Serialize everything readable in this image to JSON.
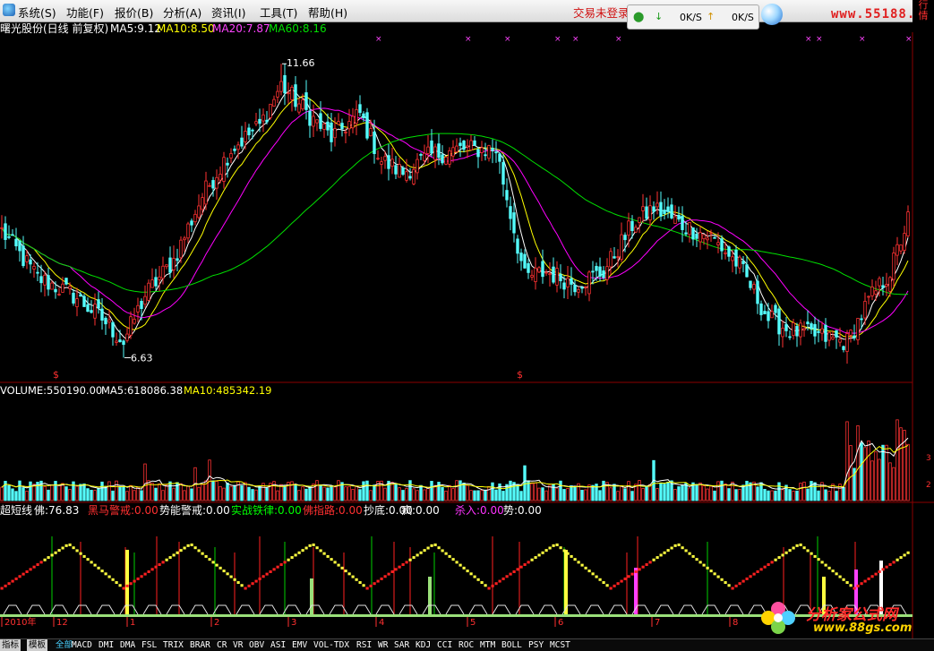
{
  "menu": [
    "系统(S)",
    "功能(F)",
    "报价(B)",
    "分析(A)",
    "资讯(I)",
    "工具(T)",
    "帮助(H)"
  ],
  "trade_status": "交易未登录",
  "speed": {
    "down": "0K/S",
    "up": "0K/S"
  },
  "site_url": "www.55188.com",
  "right_tab": [
    "行",
    "情"
  ],
  "colors": {
    "background": "#000000",
    "up": "#ff3232",
    "down": "#54fcfc",
    "ma5": "#ffffff",
    "ma10": "#ffff00",
    "ma20": "#ff00ff",
    "ma60": "#00e000"
  },
  "price_panel": {
    "title": "曙光股份(日线 前复权)",
    "ma": [
      {
        "label": "MA5:9.12",
        "color": "#ffffff"
      },
      {
        "label": "MA10:8.50",
        "color": "#ffff00"
      },
      {
        "label": "MA20:7.87",
        "color": "#ff44ff"
      },
      {
        "label": "MA60:8.16",
        "color": "#00e000"
      }
    ],
    "high_label": "11.66",
    "low_label": "6.63",
    "dollar": "$",
    "markers": "×"
  },
  "volume_panel": {
    "label": "VOLUME:550190.00",
    "ma5": "MA5:618086.38",
    "ma10": "MA10:485342.19",
    "scale_top": "3",
    "scale_mid": "2"
  },
  "indicator_panel": {
    "name": "超短线",
    "items": [
      {
        "label": "佛:76.83",
        "color": "#ffffff"
      },
      {
        "label": "黑马警戒:0.00",
        "color": "#ff3030"
      },
      {
        "label": "势能警戒:0.00",
        "color": "#ffffff"
      },
      {
        "label": "实战铁律:0.00",
        "color": "#00ff00"
      },
      {
        "label": "佛指路:0.00",
        "color": "#ff3030"
      },
      {
        "label": "抄底:0.00",
        "color": "#ffffff"
      },
      {
        "label": "疯:0.00",
        "color": "#ffffff"
      },
      {
        "label": "杀入:0.00",
        "color": "#ff33ff"
      },
      {
        "label": "势:0.00",
        "color": "#ffffff"
      }
    ]
  },
  "time_axis": [
    "2010年",
    "12",
    "1",
    "2",
    "3",
    "4",
    "5",
    "6",
    "7",
    "8"
  ],
  "bottom_tabs": [
    "指标",
    "模板",
    "全部",
    "MACD",
    "DMI",
    "DMA",
    "FSL",
    "TRIX",
    "BRAR",
    "CR",
    "VR",
    "OBV",
    "ASI",
    "EMV",
    "VOL-TDX",
    "RSI",
    "WR",
    "SAR",
    "KDJ",
    "CCI",
    "ROC",
    "MTM",
    "BOLL",
    "PSY",
    "MCST"
  ],
  "bottom_logo": {
    "title": "分析家公式网",
    "url": "www.88gs.com"
  },
  "chart_data": {
    "type": "candlestick",
    "price_range": [
      6.3,
      12.2
    ],
    "high": 11.66,
    "low": 6.63,
    "last_ma": {
      "ma5": 9.12,
      "ma10": 8.5,
      "ma20": 7.87,
      "ma60": 8.16
    },
    "price_anchors": [
      [
        0,
        8.8
      ],
      [
        10,
        8.0
      ],
      [
        20,
        7.7
      ],
      [
        28,
        7.3
      ],
      [
        34,
        6.9
      ],
      [
        40,
        7.7
      ],
      [
        48,
        8.3
      ],
      [
        56,
        9.4
      ],
      [
        64,
        10.2
      ],
      [
        72,
        10.6
      ],
      [
        78,
        11.3
      ],
      [
        84,
        10.9
      ],
      [
        92,
        10.4
      ],
      [
        100,
        10.8
      ],
      [
        106,
        10.0
      ],
      [
        112,
        9.8
      ],
      [
        120,
        10.1
      ],
      [
        128,
        10.2
      ],
      [
        138,
        10.2
      ],
      [
        146,
        8.0
      ],
      [
        152,
        8.1
      ],
      [
        160,
        7.9
      ],
      [
        168,
        8.1
      ],
      [
        176,
        8.9
      ],
      [
        182,
        9.2
      ],
      [
        190,
        8.9
      ],
      [
        198,
        8.7
      ],
      [
        206,
        8.2
      ],
      [
        214,
        7.3
      ],
      [
        220,
        7.1
      ],
      [
        228,
        7.0
      ],
      [
        236,
        6.9
      ],
      [
        242,
        7.6
      ],
      [
        248,
        8.1
      ],
      [
        253,
        9.0
      ]
    ],
    "volume_range": [
      0,
      1000000
    ],
    "volume_last": 550190,
    "volume_ma5": 618086.38,
    "volume_ma10": 485342.19
  }
}
